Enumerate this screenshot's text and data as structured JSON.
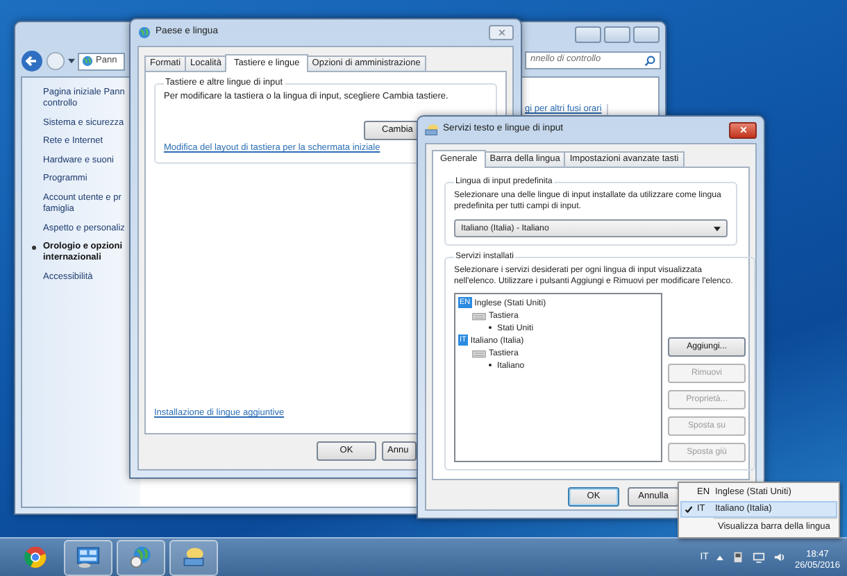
{
  "control_panel": {
    "address": "Pann",
    "search_placeholder": "nnello di controllo",
    "link": "gi per altri fusi orari",
    "sidebar": [
      {
        "label": "Pagina iniziale Pann\ncontrollo",
        "selected": false
      },
      {
        "label": "Sistema e sicurezza",
        "selected": false
      },
      {
        "label": "Rete e Internet",
        "selected": false
      },
      {
        "label": "Hardware e suoni",
        "selected": false
      },
      {
        "label": "Programmi",
        "selected": false
      },
      {
        "label": "Account utente e pr\nfamiglia",
        "selected": false
      },
      {
        "label": "Aspetto e personaliz",
        "selected": false
      },
      {
        "label": "Orologio e opzioni\ninternazionali",
        "selected": true
      },
      {
        "label": "Accessibilità",
        "selected": false
      }
    ]
  },
  "region_dialog": {
    "title": "Paese e lingua",
    "tabs": [
      {
        "label": "Formati",
        "selected": false
      },
      {
        "label": "Località",
        "selected": false
      },
      {
        "label": "Tastiere e lingue",
        "selected": true
      },
      {
        "label": "Opzioni di amministrazione",
        "selected": false
      }
    ],
    "group_title": "Tastiere e altre lingue di input",
    "description": "Per modificare la tastiera o la lingua di input, scegliere Cambia tastiere.",
    "change_button": "Cambia",
    "layout_link": "Modifica del layout di tastiera per la schermata iniziale",
    "install_link": "Installazione di lingue aggiuntive",
    "buttons": [
      "OK",
      "Annu"
    ]
  },
  "text_services_dialog": {
    "title": "Servizi testo e lingue di input",
    "tabs": [
      {
        "label": "Generale",
        "selected": true
      },
      {
        "label": "Barra della lingua",
        "selected": false
      },
      {
        "label": "Impostazioni avanzate tasti",
        "selected": false
      }
    ],
    "default_group": {
      "title": "Lingua di input predefinita",
      "description": "Selezionare una delle lingue di input installate da utilizzare come lingua predefinita per tutti campi di input.",
      "dropdown": "Italiano (Italia) - Italiano"
    },
    "installed_group": {
      "title": "Servizi installati",
      "description": "Selezionare i servizi desiderati per ogni lingua di input visualizzata nell'elenco. Utilizzare i pulsanti Aggiungi e Rimuovi per modificare l'elenco.",
      "tree": [
        {
          "code": "EN",
          "label": "Inglese (Stati Uniti)",
          "children": [
            {
              "label": "Tastiera",
              "children": [
                {
                  "label": "Stati Uniti"
                }
              ]
            }
          ]
        },
        {
          "code": "IT",
          "label": "Italiano (Italia)",
          "children": [
            {
              "label": "Tastiera",
              "children": [
                {
                  "label": "Italiano"
                }
              ]
            }
          ]
        }
      ],
      "buttons": [
        {
          "label": "Aggiungi...",
          "disabled": false
        },
        {
          "label": "Rimuovi",
          "disabled": true
        },
        {
          "label": "Proprietà...",
          "disabled": true
        },
        {
          "label": "Sposta su",
          "disabled": true
        },
        {
          "label": "Sposta giù",
          "disabled": true
        }
      ]
    },
    "buttons": [
      "OK",
      "Annulla"
    ]
  },
  "language_menu": {
    "items": [
      {
        "code": "EN",
        "label": "Inglese (Stati Uniti)",
        "selected": false
      },
      {
        "code": "IT",
        "label": "Italiano (Italia)",
        "selected": true
      }
    ],
    "toolbar_item": "Visualizza barra della lingua"
  },
  "taskbar": {
    "apps": [
      {
        "kind": "browser",
        "running": false
      },
      {
        "kind": "control-panel",
        "running": true
      },
      {
        "kind": "globe",
        "running": true
      },
      {
        "kind": "keyboard",
        "running": true
      }
    ],
    "language": "IT",
    "time": "18:47",
    "date": "26/05/2016"
  }
}
